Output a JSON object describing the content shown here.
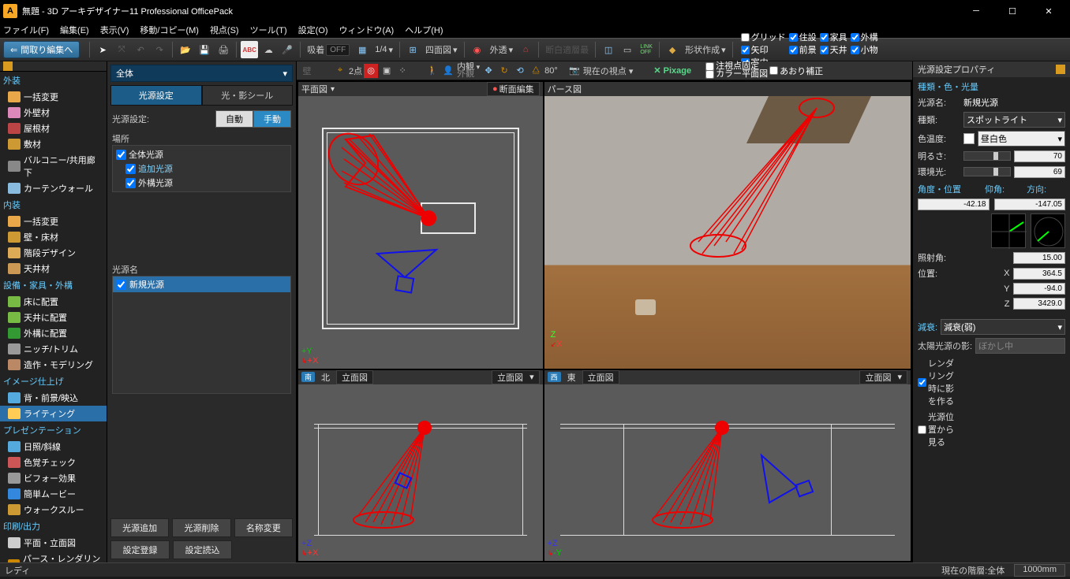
{
  "title": "無題 - 3D アーキデザイナー11 Professional OfficePack",
  "menu": [
    "ファイル(F)",
    "編集(E)",
    "表示(V)",
    "移動/コピー(M)",
    "視点(S)",
    "ツール(T)",
    "設定(O)",
    "ウィンドウ(A)",
    "ヘルプ(H)"
  ],
  "back_button": "間取り編集へ",
  "snap": {
    "label": "吸着",
    "state": "OFF"
  },
  "grid_ratio": "1/4",
  "view_mode_label": "四面図",
  "outer_label": "外透",
  "shape_label": "形状作成",
  "display_checks": [
    {
      "label": "グリッド",
      "checked": false
    },
    {
      "label": "住設",
      "checked": true
    },
    {
      "label": "家具",
      "checked": true
    },
    {
      "label": "外構",
      "checked": true
    },
    {
      "label": "矢印",
      "checked": true
    },
    {
      "label": "前景",
      "checked": true
    },
    {
      "label": "天井",
      "checked": true
    },
    {
      "label": "小物",
      "checked": true
    },
    {
      "label": "室内",
      "checked": true
    }
  ],
  "outline_combo": "全体",
  "outline_tabs": [
    "光源設定",
    "光・影シール"
  ],
  "light_setting_label": "光源設定:",
  "light_modes": [
    "自動",
    "手動"
  ],
  "place_label": "場所",
  "place_items": [
    {
      "label": "全体光源",
      "checked": true,
      "sel": false
    },
    {
      "label": "追加光源",
      "checked": true,
      "sel": true
    },
    {
      "label": "外構光源",
      "checked": true,
      "sel": false
    }
  ],
  "lightname_label": "光源名",
  "lightname_items": [
    "新規光源"
  ],
  "outline_buttons": [
    "光源追加",
    "光源削除",
    "名称変更",
    "設定登録",
    "設定読込"
  ],
  "left_tree": {
    "cats": [
      {
        "name": "外装",
        "items": [
          "一括変更",
          "外壁材",
          "屋根材",
          "敷材",
          "バルコニー/共用廊下",
          "カーテンウォール"
        ]
      },
      {
        "name": "内装",
        "items": [
          "一括変更",
          "壁・床材",
          "階段デザイン",
          "天井材"
        ]
      },
      {
        "name": "設備・家具・外構",
        "items": [
          "床に配置",
          "天井に配置",
          "外構に配置",
          "ニッチ/トリム",
          "造作・モデリング"
        ]
      },
      {
        "name": "イメージ仕上げ",
        "items": [
          "背・前景/映込",
          "ライティング"
        ]
      },
      {
        "name": "プレゼンテーション",
        "items": [
          "日照/斜線",
          "色覚チェック",
          "ビフォー効果",
          "簡単ムービー",
          "ウォークスルー"
        ]
      },
      {
        "name": "印刷/出力",
        "items": [
          "平面・立面図",
          "パース・レンダリング"
        ]
      }
    ],
    "active": "ライティング"
  },
  "view_toolbar": {
    "points": "2点",
    "angle": "80°",
    "interior": "内観",
    "exterior": "外観",
    "viewpoint": "現在の視点",
    "pixage": "Pixage",
    "opts": [
      "注視点固定",
      "カラー平面図",
      "あおり補正"
    ]
  },
  "viewports": {
    "tl": {
      "title": "平面図",
      "edge": "断面編集"
    },
    "tr": {
      "title": "パース図"
    },
    "bl": {
      "pills": [
        "南",
        "北"
      ],
      "dd": "立面図",
      "dd2": "立面図"
    },
    "br": {
      "pills": [
        "西",
        "東"
      ],
      "dd": "立面図",
      "dd2": "立面図"
    }
  },
  "props": {
    "title": "光源設定プロパティ",
    "sec1": "種類・色・光量",
    "name_label": "光源名:",
    "name": "新規光源",
    "type_label": "種類:",
    "type": "スポットライト",
    "temp_label": "色温度:",
    "temp": "昼白色",
    "bright_label": "明るさ:",
    "bright": "70",
    "env_label": "環境光:",
    "env": "69",
    "sec2": "角度・位置",
    "elev_label": "仰角:",
    "dir_label": "方向:",
    "elev": "-42.18",
    "dir": "-147.05",
    "irr_label": "照射角:",
    "irr": "15.00",
    "pos_label": "位置:",
    "x": "364.5",
    "y": "-94.0",
    "z": "3429.0",
    "sec3": "減衰:",
    "decay": "減衰(弱)",
    "sun_label": "太陽光源の影:",
    "sun": "ぼかし中",
    "ck1": "レンダリング時に影を作る",
    "ck2": "光源位置から見る"
  },
  "status": {
    "left": "レディ",
    "floor": "現在の階層:全体",
    "zoom": "1000mm"
  }
}
